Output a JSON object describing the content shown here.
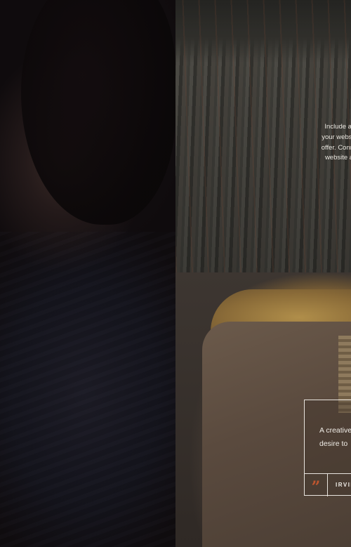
{
  "about": {
    "lines": [
      "Include a detaile",
      "your website. Intro",
      "offer. Connect with",
      "website an esse"
    ]
  },
  "testimonial": {
    "quote_lines": [
      "A creative",
      "desire to"
    ],
    "quote_icon": "quote-mark-icon",
    "quote_glyph": "”",
    "author": "IRVIN",
    "accent_color": "#c0562f"
  }
}
